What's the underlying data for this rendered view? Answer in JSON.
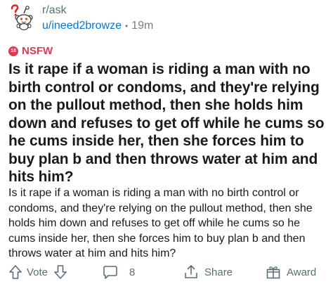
{
  "header": {
    "subreddit": "r/ask",
    "username": "u/ineed2browze",
    "separator": "•",
    "time": "19m"
  },
  "nsfw": {
    "badge": "18",
    "label": "NSFW"
  },
  "post": {
    "title": "Is it rape if a woman is riding a man with no birth control or condoms, and they're relying on the pullout method, then she holds him down and refuses to get off while he cums so he cums inside her, then she forces him to buy plan b and then throws water at him and hits him?",
    "body": "Is it rape if a woman is riding a man with no birth control or condoms, and they're relying on the pullout method, then she holds him down and refuses to get off while he cums so he cums inside her, then she forces him to buy plan b and then throws water at him and hits him?"
  },
  "actions": {
    "vote_label": "Vote",
    "comment_count": "8",
    "share_label": "Share",
    "award_label": "Award"
  },
  "colors": {
    "nsfw": "#d93a57",
    "username": "#0079d3",
    "muted": "#576f76"
  },
  "icons": {
    "avatar": "reddit-snoo-question-avatar",
    "upvote": "arrow-up-icon",
    "downvote": "arrow-down-icon",
    "comment": "speech-bubble-icon",
    "share": "share-upload-icon",
    "award": "gift-box-icon"
  }
}
